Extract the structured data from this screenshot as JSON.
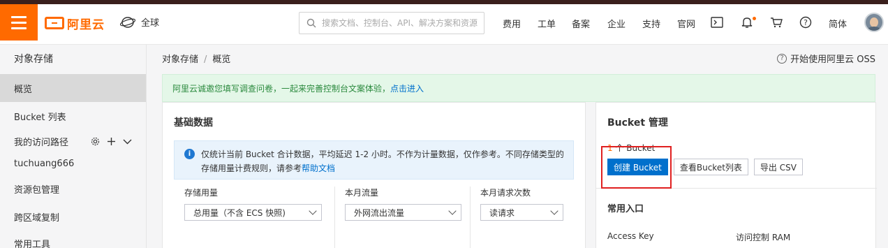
{
  "header": {
    "logo_text": "阿里云",
    "region": "全球",
    "search_placeholder": "搜索文档、控制台、API、解决方案和资源",
    "nav": [
      "费用",
      "工单",
      "备案",
      "企业",
      "支持",
      "官网"
    ],
    "language": "简体",
    "accent_color": "#ff6a00"
  },
  "sidebar": {
    "title": "对象存储",
    "items": {
      "overview": "概览",
      "bucket_list": "Bucket 列表",
      "my_paths": "我的访问路径",
      "path_item": "tuchuang666",
      "resource_pack": "资源包管理",
      "cross_region": "跨区域复制",
      "tools": "常用工具"
    }
  },
  "breadcrumb": {
    "root": "对象存储",
    "sep": "/",
    "current": "概览"
  },
  "help_link": "开始使用阿里云 OSS",
  "notice": {
    "text": "阿里云诚邀您填写调查问卷，一起来完善控制台文案体验，",
    "link": "点击进入"
  },
  "basic_data": {
    "title": "基础数据",
    "info_text": "仅统计当前 Bucket 合计数据，平均延迟 1-2 小时。不作为计量数据，仅作参考。不同存储类型的存储用量计费规则，请参考",
    "info_link": "帮助文档",
    "columns": [
      {
        "label": "存储用量",
        "select": "总用量（不含 ECS 快照)"
      },
      {
        "label": "本月流量",
        "select": "外网流出流量"
      },
      {
        "label": "本月请求次数",
        "select": "读请求"
      }
    ]
  },
  "bucket_mgmt": {
    "title": "Bucket 管理",
    "count": "1",
    "count_suffix": "个 Bucket",
    "create_button": "创建 Bucket",
    "list_button": "查看Bucket列表",
    "export_button": "导出 CSV",
    "common_entry_title": "常用入口",
    "entries": [
      "Access Key",
      "访问控制 RAM"
    ],
    "highlight_color": "#e02020"
  }
}
